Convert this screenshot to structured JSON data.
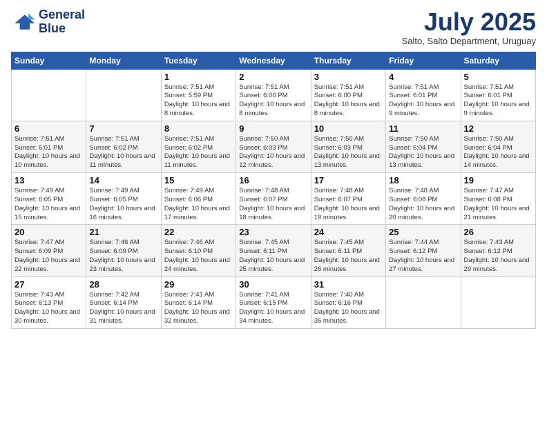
{
  "logo": {
    "line1": "General",
    "line2": "Blue"
  },
  "title": "July 2025",
  "location": "Salto, Salto Department, Uruguay",
  "days_header": [
    "Sunday",
    "Monday",
    "Tuesday",
    "Wednesday",
    "Thursday",
    "Friday",
    "Saturday"
  ],
  "weeks": [
    [
      {
        "day": "",
        "info": ""
      },
      {
        "day": "",
        "info": ""
      },
      {
        "day": "1",
        "info": "Sunrise: 7:51 AM\nSunset: 5:59 PM\nDaylight: 10 hours and 8 minutes."
      },
      {
        "day": "2",
        "info": "Sunrise: 7:51 AM\nSunset: 6:00 PM\nDaylight: 10 hours and 8 minutes."
      },
      {
        "day": "3",
        "info": "Sunrise: 7:51 AM\nSunset: 6:00 PM\nDaylight: 10 hours and 8 minutes."
      },
      {
        "day": "4",
        "info": "Sunrise: 7:51 AM\nSunset: 6:01 PM\nDaylight: 10 hours and 9 minutes."
      },
      {
        "day": "5",
        "info": "Sunrise: 7:51 AM\nSunset: 6:01 PM\nDaylight: 10 hours and 9 minutes."
      }
    ],
    [
      {
        "day": "6",
        "info": "Sunrise: 7:51 AM\nSunset: 6:01 PM\nDaylight: 10 hours and 10 minutes."
      },
      {
        "day": "7",
        "info": "Sunrise: 7:51 AM\nSunset: 6:02 PM\nDaylight: 10 hours and 11 minutes."
      },
      {
        "day": "8",
        "info": "Sunrise: 7:51 AM\nSunset: 6:02 PM\nDaylight: 10 hours and 11 minutes."
      },
      {
        "day": "9",
        "info": "Sunrise: 7:50 AM\nSunset: 6:03 PM\nDaylight: 10 hours and 12 minutes."
      },
      {
        "day": "10",
        "info": "Sunrise: 7:50 AM\nSunset: 6:03 PM\nDaylight: 10 hours and 13 minutes."
      },
      {
        "day": "11",
        "info": "Sunrise: 7:50 AM\nSunset: 6:04 PM\nDaylight: 10 hours and 13 minutes."
      },
      {
        "day": "12",
        "info": "Sunrise: 7:50 AM\nSunset: 6:04 PM\nDaylight: 10 hours and 14 minutes."
      }
    ],
    [
      {
        "day": "13",
        "info": "Sunrise: 7:49 AM\nSunset: 6:05 PM\nDaylight: 10 hours and 15 minutes."
      },
      {
        "day": "14",
        "info": "Sunrise: 7:49 AM\nSunset: 6:05 PM\nDaylight: 10 hours and 16 minutes."
      },
      {
        "day": "15",
        "info": "Sunrise: 7:49 AM\nSunset: 6:06 PM\nDaylight: 10 hours and 17 minutes."
      },
      {
        "day": "16",
        "info": "Sunrise: 7:48 AM\nSunset: 6:07 PM\nDaylight: 10 hours and 18 minutes."
      },
      {
        "day": "17",
        "info": "Sunrise: 7:48 AM\nSunset: 6:07 PM\nDaylight: 10 hours and 19 minutes."
      },
      {
        "day": "18",
        "info": "Sunrise: 7:48 AM\nSunset: 6:08 PM\nDaylight: 10 hours and 20 minutes."
      },
      {
        "day": "19",
        "info": "Sunrise: 7:47 AM\nSunset: 6:08 PM\nDaylight: 10 hours and 21 minutes."
      }
    ],
    [
      {
        "day": "20",
        "info": "Sunrise: 7:47 AM\nSunset: 6:09 PM\nDaylight: 10 hours and 22 minutes."
      },
      {
        "day": "21",
        "info": "Sunrise: 7:46 AM\nSunset: 6:09 PM\nDaylight: 10 hours and 23 minutes."
      },
      {
        "day": "22",
        "info": "Sunrise: 7:46 AM\nSunset: 6:10 PM\nDaylight: 10 hours and 24 minutes."
      },
      {
        "day": "23",
        "info": "Sunrise: 7:45 AM\nSunset: 6:11 PM\nDaylight: 10 hours and 25 minutes."
      },
      {
        "day": "24",
        "info": "Sunrise: 7:45 AM\nSunset: 6:11 PM\nDaylight: 10 hours and 26 minutes."
      },
      {
        "day": "25",
        "info": "Sunrise: 7:44 AM\nSunset: 6:12 PM\nDaylight: 10 hours and 27 minutes."
      },
      {
        "day": "26",
        "info": "Sunrise: 7:43 AM\nSunset: 6:12 PM\nDaylight: 10 hours and 29 minutes."
      }
    ],
    [
      {
        "day": "27",
        "info": "Sunrise: 7:43 AM\nSunset: 6:13 PM\nDaylight: 10 hours and 30 minutes."
      },
      {
        "day": "28",
        "info": "Sunrise: 7:42 AM\nSunset: 6:14 PM\nDaylight: 10 hours and 31 minutes."
      },
      {
        "day": "29",
        "info": "Sunrise: 7:41 AM\nSunset: 6:14 PM\nDaylight: 10 hours and 32 minutes."
      },
      {
        "day": "30",
        "info": "Sunrise: 7:41 AM\nSunset: 6:15 PM\nDaylight: 10 hours and 34 minutes."
      },
      {
        "day": "31",
        "info": "Sunrise: 7:40 AM\nSunset: 6:16 PM\nDaylight: 10 hours and 35 minutes."
      },
      {
        "day": "",
        "info": ""
      },
      {
        "day": "",
        "info": ""
      }
    ]
  ]
}
